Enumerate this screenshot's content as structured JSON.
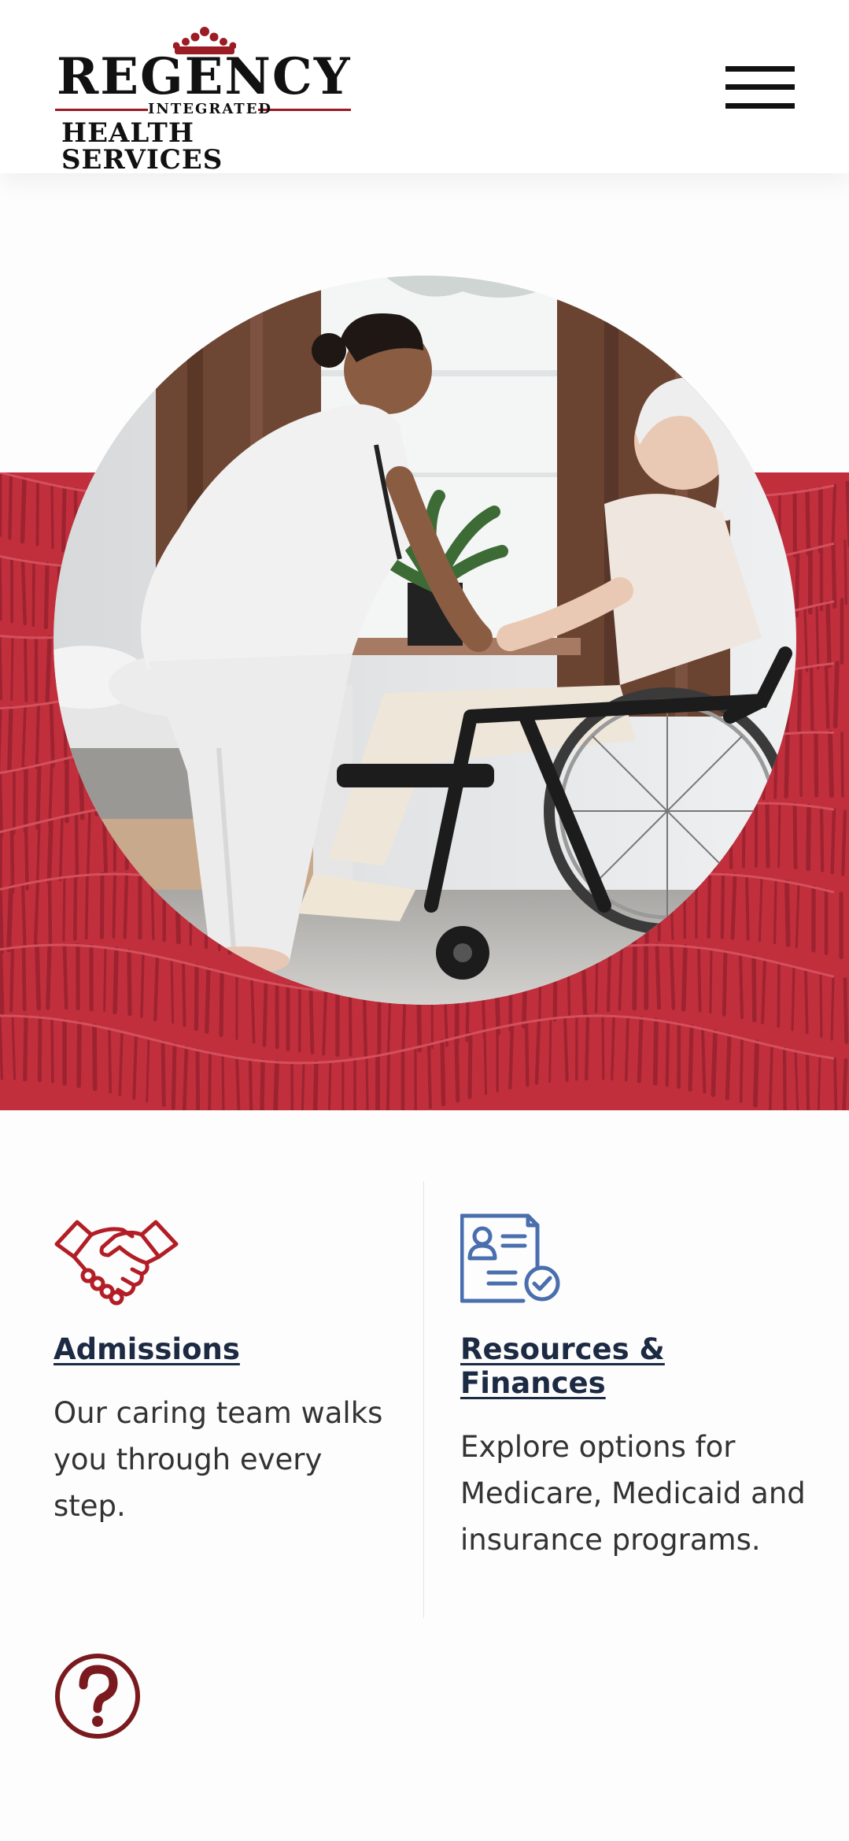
{
  "brand": {
    "name": "Regency",
    "line1": "REGENCY",
    "line2": "INTEGRATED",
    "line3": "HEALTH SERVICES",
    "registered_mark": "®",
    "colors": {
      "red": "#9b1c24",
      "black": "#111111"
    }
  },
  "header": {
    "menu_icon": "hamburger-menu-icon"
  },
  "hero": {
    "background_color": "#c12f3d",
    "image_description_icon": "caregiver-photo"
  },
  "cards": [
    {
      "icon": "handshake-icon",
      "icon_color": "#b31d25",
      "title": "Admissions",
      "text": "Our caring team walks you through every step."
    },
    {
      "icon": "document-check-icon",
      "icon_color": "#4a6fae",
      "title": "Resources & Finances",
      "text": "Explore options for Medicare, Medicaid and insurance programs."
    }
  ],
  "help": {
    "icon": "question-circle-icon",
    "color": "#7a1a1e"
  },
  "colors": {
    "title_navy": "#1c2a44",
    "body_text": "#333333"
  }
}
